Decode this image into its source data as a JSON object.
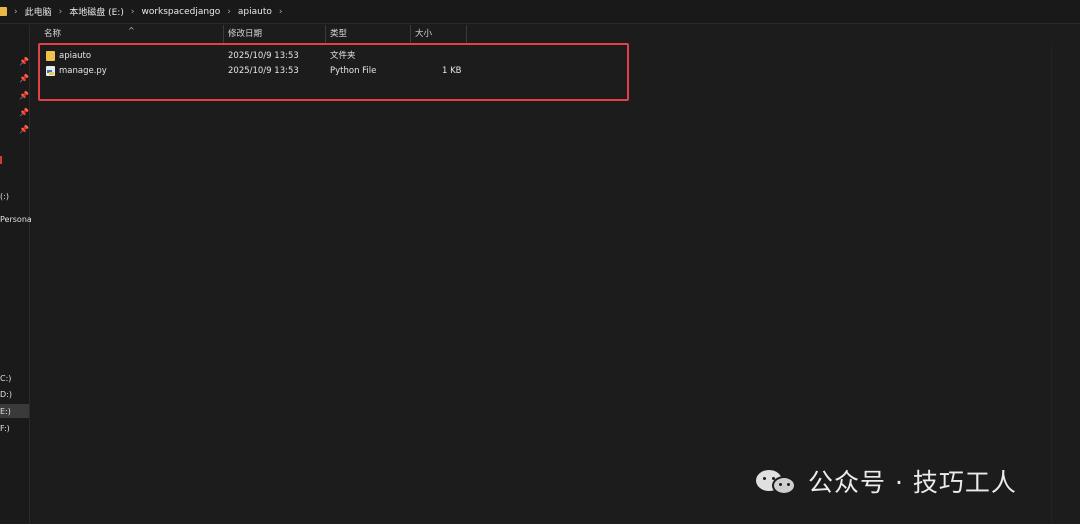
{
  "breadcrumb": {
    "items": [
      "此电脑",
      "本地磁盘 (E:)",
      "workspacedjango",
      "apiauto"
    ],
    "separator": "›"
  },
  "nav": {
    "fragments": [
      "(:)",
      "Persona",
      "C:)",
      "D:)",
      "E:)",
      "F:)"
    ]
  },
  "columns": {
    "name": "名称",
    "modified": "修改日期",
    "type": "类型",
    "size": "大小",
    "sort_indicator": "^"
  },
  "files": [
    {
      "name": "apiauto",
      "modified": "2025/10/9 13:53",
      "type": "文件夹",
      "size": "",
      "icon": "folder-icon"
    },
    {
      "name": "manage.py",
      "modified": "2025/10/9 13:53",
      "type": "Python File",
      "size": "1 KB",
      "icon": "python-file-icon"
    }
  ],
  "watermark": {
    "text": "公众号 · 技巧工人",
    "icon": "wechat-icon"
  },
  "colors": {
    "highlight": "#e0424a",
    "folder": "#f0c14b",
    "background": "#1c1c1c"
  }
}
